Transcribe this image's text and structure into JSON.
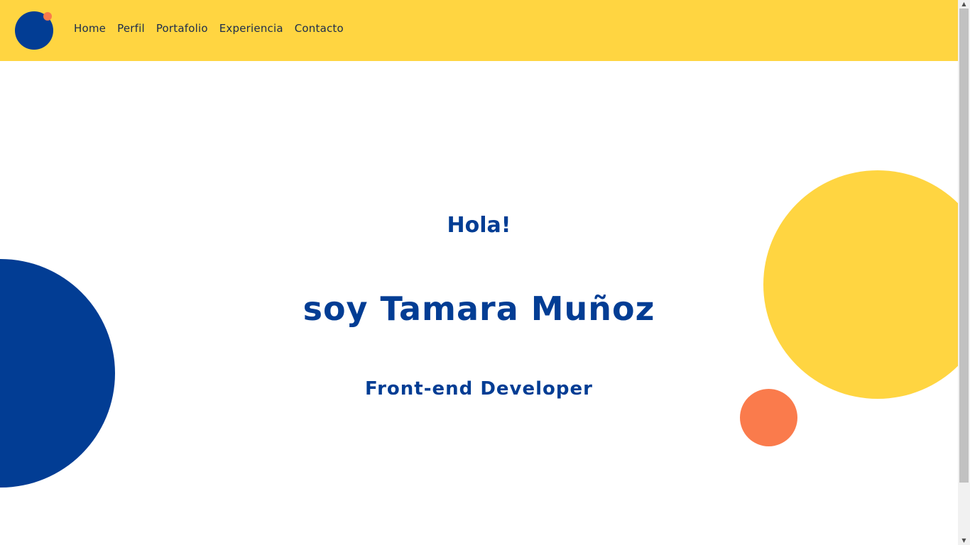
{
  "nav": {
    "items": [
      {
        "label": "Home"
      },
      {
        "label": "Perfil"
      },
      {
        "label": "Portafolio"
      },
      {
        "label": "Experiencia"
      },
      {
        "label": "Contacto"
      }
    ]
  },
  "hero": {
    "greeting": "Hola!",
    "name": "soy Tamara Muñoz",
    "role": "Front-end Developer"
  },
  "colors": {
    "accent_yellow": "#ffd541",
    "brand_blue": "#023d94",
    "accent_orange": "#fa7b4c"
  }
}
